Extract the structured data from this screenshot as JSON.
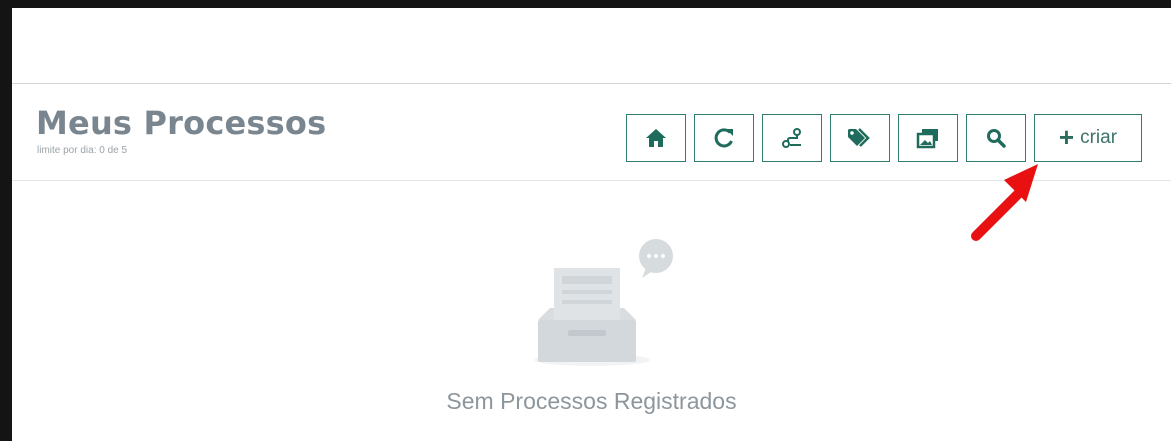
{
  "page": {
    "title": "Meus Processos",
    "limit_text": "limite por dia: 0 de 5"
  },
  "toolbar": {
    "buttons": [
      {
        "icon": "home-icon"
      },
      {
        "icon": "refresh-icon"
      },
      {
        "icon": "route-icon"
      },
      {
        "icon": "tags-icon"
      },
      {
        "icon": "images-icon"
      },
      {
        "icon": "search-icon"
      }
    ],
    "create_label": "criar",
    "accent_color": "#2f7e6e"
  },
  "empty_state": {
    "icon": "empty-inbox-icon",
    "message": "Sem Processos Registrados"
  },
  "annotation": {
    "icon": "red-arrow-icon",
    "color": "#e81010"
  }
}
